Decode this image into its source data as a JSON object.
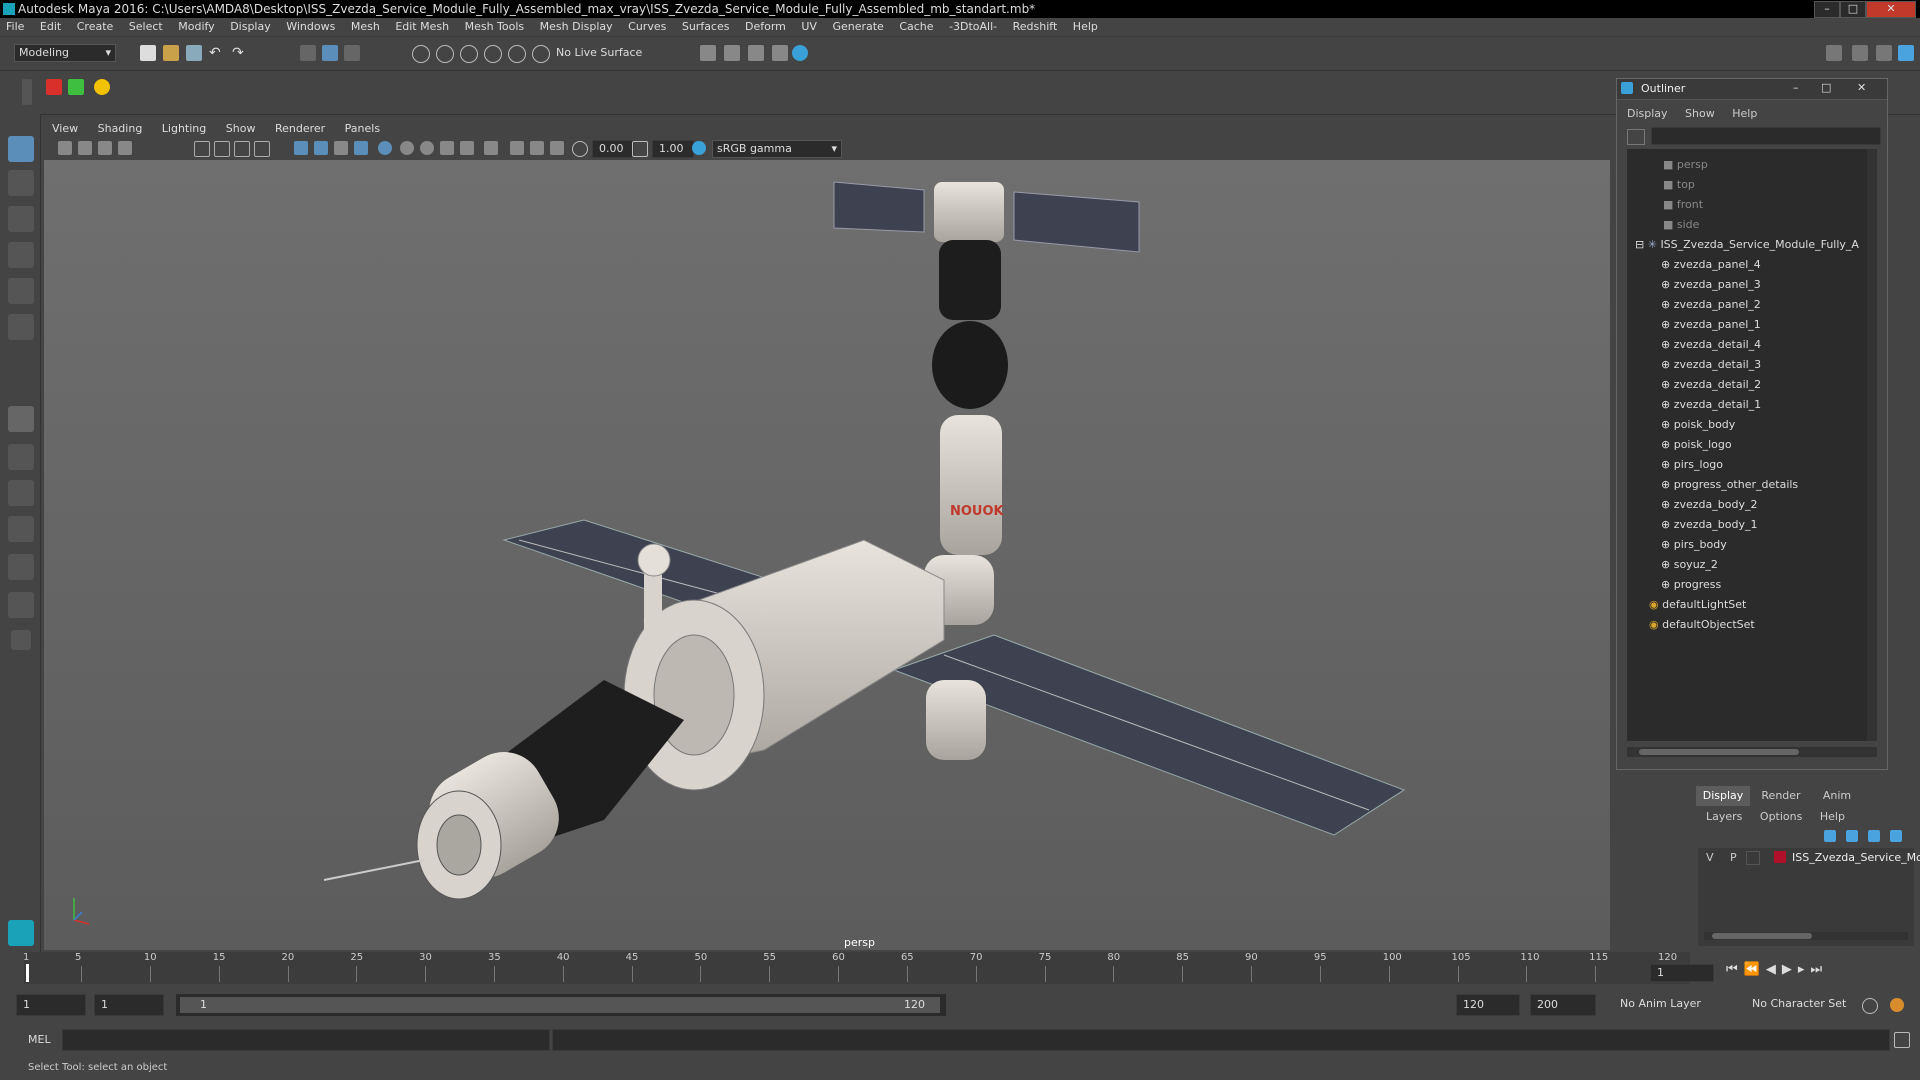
{
  "title_bar": {
    "title": "Autodesk Maya 2016: C:\\Users\\AMDA8\\Desktop\\ISS_Zvezda_Service_Module_Fully_Assembled_max_vray\\ISS_Zvezda_Service_Module_Fully_Assembled_mb_standart.mb*",
    "minimize": "–",
    "maximize": "□",
    "close": "✕"
  },
  "menu": [
    "File",
    "Edit",
    "Create",
    "Select",
    "Modify",
    "Display",
    "Windows",
    "Mesh",
    "Edit Mesh",
    "Mesh Tools",
    "Mesh Display",
    "Curves",
    "Surfaces",
    "Deform",
    "UV",
    "Generate",
    "Cache",
    "-3DtoAll-",
    "Redshift",
    "Help"
  ],
  "status_line": {
    "mode": "Modeling",
    "live_surface": "No Live Surface"
  },
  "viewport": {
    "menu": [
      "View",
      "Shading",
      "Lighting",
      "Show",
      "Renderer",
      "Panels"
    ],
    "exposure": "0.00",
    "gamma": "1.00",
    "color_space": "sRGB gamma",
    "camera_label": "persp"
  },
  "outliner": {
    "title": "Outliner",
    "menu": [
      "Display",
      "Show",
      "Help"
    ],
    "cameras": [
      "persp",
      "top",
      "front",
      "side"
    ],
    "root": "ISS_Zvezda_Service_Module_Fully_A",
    "children": [
      "zvezda_panel_4",
      "zvezda_panel_3",
      "zvezda_panel_2",
      "zvezda_panel_1",
      "zvezda_detail_4",
      "zvezda_detail_3",
      "zvezda_detail_2",
      "zvezda_detail_1",
      "poisk_body",
      "poisk_logo",
      "pirs_logo",
      "progress_other_details",
      "zvezda_body_2",
      "zvezda_body_1",
      "pirs_body",
      "soyuz_2",
      "progress"
    ],
    "sets": [
      "defaultLightSet",
      "defaultObjectSet"
    ]
  },
  "layer_editor": {
    "tabs": [
      "Display",
      "Render",
      "Anim"
    ],
    "menu": [
      "Layers",
      "Options",
      "Help"
    ],
    "layer": {
      "v": "V",
      "p": "P",
      "name": "ISS_Zvezda_Service_Moc",
      "color": "#b0102a"
    }
  },
  "time_slider": {
    "ticks": [
      "5",
      "10",
      "15",
      "20",
      "25",
      "30",
      "35",
      "40",
      "45",
      "50",
      "55",
      "60",
      "65",
      "70",
      "75",
      "80",
      "85",
      "90",
      "95",
      "100",
      "105",
      "110",
      "115",
      "120"
    ],
    "start_tick": "1",
    "current_frame": "1"
  },
  "range_slider": {
    "start": "1",
    "playback_start": "1",
    "range_start_label": "1",
    "range_end_label": "120",
    "playback_end": "120",
    "end": "200",
    "anim_layer": "No Anim Layer",
    "character_set": "No Character Set"
  },
  "command_line": {
    "label": "MEL"
  },
  "help_line": {
    "text": "Select Tool: select an object"
  }
}
